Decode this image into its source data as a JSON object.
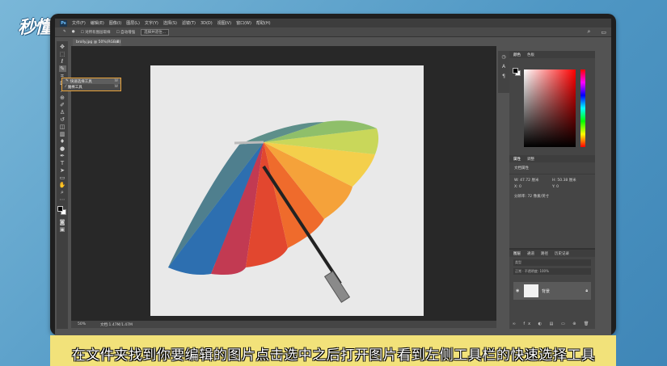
{
  "watermark": {
    "logo_text": "秒懂视频"
  },
  "app": {
    "name": "Photoshop",
    "logo": "Ps",
    "menu": [
      "文件(F)",
      "编辑(E)",
      "图像(I)",
      "图层(L)",
      "文字(Y)",
      "选择(S)",
      "滤镜(T)",
      "3D(D)",
      "视图(V)",
      "窗口(W)",
      "帮助(H)"
    ],
    "options": {
      "sample_all_layers": "对所有图层取样",
      "auto_enhance": "自动增强",
      "select_and_mask": "选择并遮住..."
    },
    "document_tab": {
      "label": "brolly.jpg @ 50%(RGB/8)",
      "close": "×"
    },
    "flyout": {
      "items": [
        {
          "label": "快速选择工具",
          "key": "W"
        },
        {
          "label": "魔棒工具",
          "key": "W"
        }
      ]
    },
    "status": {
      "zoom": "50%",
      "doc_size": "文档:1.47M/1.47M"
    },
    "panels": {
      "color_tabs": [
        "颜色",
        "色板"
      ],
      "properties": {
        "tabs": [
          "属性",
          "调整"
        ],
        "title": "文档属性",
        "w_label": "W:",
        "w_value": "47.72 厘米",
        "h_label": "H:",
        "h_value": "50.38 厘米",
        "x_label": "X:",
        "x_value": "0",
        "y_label": "Y:",
        "y_value": "0",
        "resolution": "分辨率: 72 像素/英寸"
      },
      "layers": {
        "tabs": [
          "图层",
          "通道",
          "路径",
          "历史记录"
        ],
        "kind": "类型",
        "blend": "正常",
        "opacity": "不透明度: 100%",
        "fill": "填充: 100%",
        "layer_name": "背景"
      }
    }
  },
  "subtitle": "在文件夹找到你要编辑的图片点击选中之后打开图片看到左侧工具栏的快速选择工具",
  "colors": {
    "accent": "#e9a33a",
    "subtitle_band": "#f2e27a",
    "ps_bg": "#535353"
  }
}
